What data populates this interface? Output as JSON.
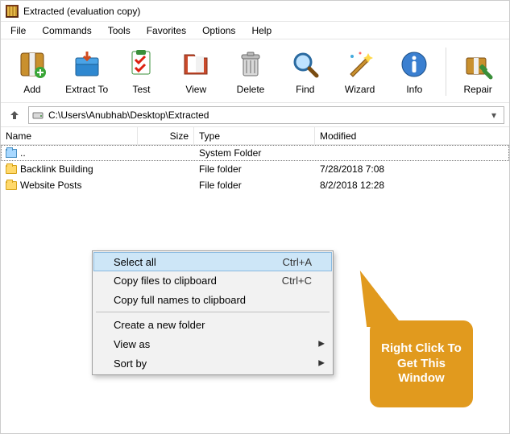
{
  "window": {
    "title": "Extracted (evaluation copy)"
  },
  "menu": {
    "file": "File",
    "commands": "Commands",
    "tools": "Tools",
    "favorites": "Favorites",
    "options": "Options",
    "help": "Help"
  },
  "toolbar": {
    "add": "Add",
    "extract": "Extract To",
    "test": "Test",
    "view": "View",
    "delete": "Delete",
    "find": "Find",
    "wizard": "Wizard",
    "info": "Info",
    "repair": "Repair"
  },
  "address": {
    "path": "C:\\Users\\Anubhab\\Desktop\\Extracted"
  },
  "columns": {
    "name": "Name",
    "size": "Size",
    "type": "Type",
    "modified": "Modified"
  },
  "rows": [
    {
      "name": "..",
      "size": "",
      "type": "System Folder",
      "modified": "",
      "up": true
    },
    {
      "name": "Backlink Building",
      "size": "",
      "type": "File folder",
      "modified": "7/28/2018 7:08"
    },
    {
      "name": "Website Posts",
      "size": "",
      "type": "File folder",
      "modified": "8/2/2018 12:28"
    }
  ],
  "context_menu": {
    "select_all": {
      "label": "Select all",
      "shortcut": "Ctrl+A"
    },
    "copy_files": {
      "label": "Copy files to clipboard",
      "shortcut": "Ctrl+C"
    },
    "copy_names": {
      "label": "Copy full names to clipboard",
      "shortcut": ""
    },
    "create_folder": {
      "label": "Create a new folder",
      "shortcut": ""
    },
    "view_as": {
      "label": "View as",
      "shortcut": ""
    },
    "sort_by": {
      "label": "Sort by",
      "shortcut": ""
    }
  },
  "callout": {
    "text": "Right Click To Get This Window"
  }
}
